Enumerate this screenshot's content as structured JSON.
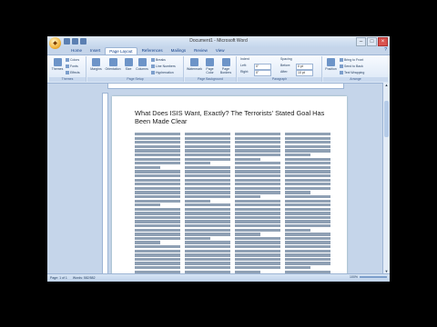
{
  "window": {
    "title": "Document1 - Microsoft Word"
  },
  "tabs": [
    "Home",
    "Insert",
    "Page Layout",
    "References",
    "Mailings",
    "Review",
    "View"
  ],
  "active_tab": "Page Layout",
  "ribbon": {
    "themes": {
      "label": "Themes",
      "buttons": [
        "Colors",
        "Fonts",
        "Effects"
      ]
    },
    "page_setup": {
      "label": "Page Setup",
      "buttons": [
        "Margins",
        "Orientation",
        "Size",
        "Columns"
      ],
      "small": [
        "Breaks",
        "Line Numbers",
        "Hyphenation"
      ]
    },
    "page_background": {
      "label": "Page Background",
      "buttons": [
        "Watermark",
        "Page Color",
        "Page Borders"
      ]
    },
    "paragraph": {
      "label": "Paragraph",
      "indent_label": "Indent",
      "spacing_label": "Spacing",
      "left_label": "Left:",
      "right_label": "Right:",
      "before_label": "Before:",
      "after_label": "After:",
      "left": "0\"",
      "right": "0\"",
      "before": "0 pt",
      "after": "10 pt"
    },
    "arrange": {
      "label": "Arrange",
      "buttons": [
        "Position",
        "Bring to Front",
        "Send to Back",
        "Text Wrapping"
      ]
    }
  },
  "document": {
    "heading": "What Does ISIS Want, Exactly? The Terrorists' Stated Goal Has Been Made Clear"
  },
  "status": {
    "page": "Page: 1 of 1",
    "words": "Words: 582/582",
    "zoom": "100%"
  }
}
